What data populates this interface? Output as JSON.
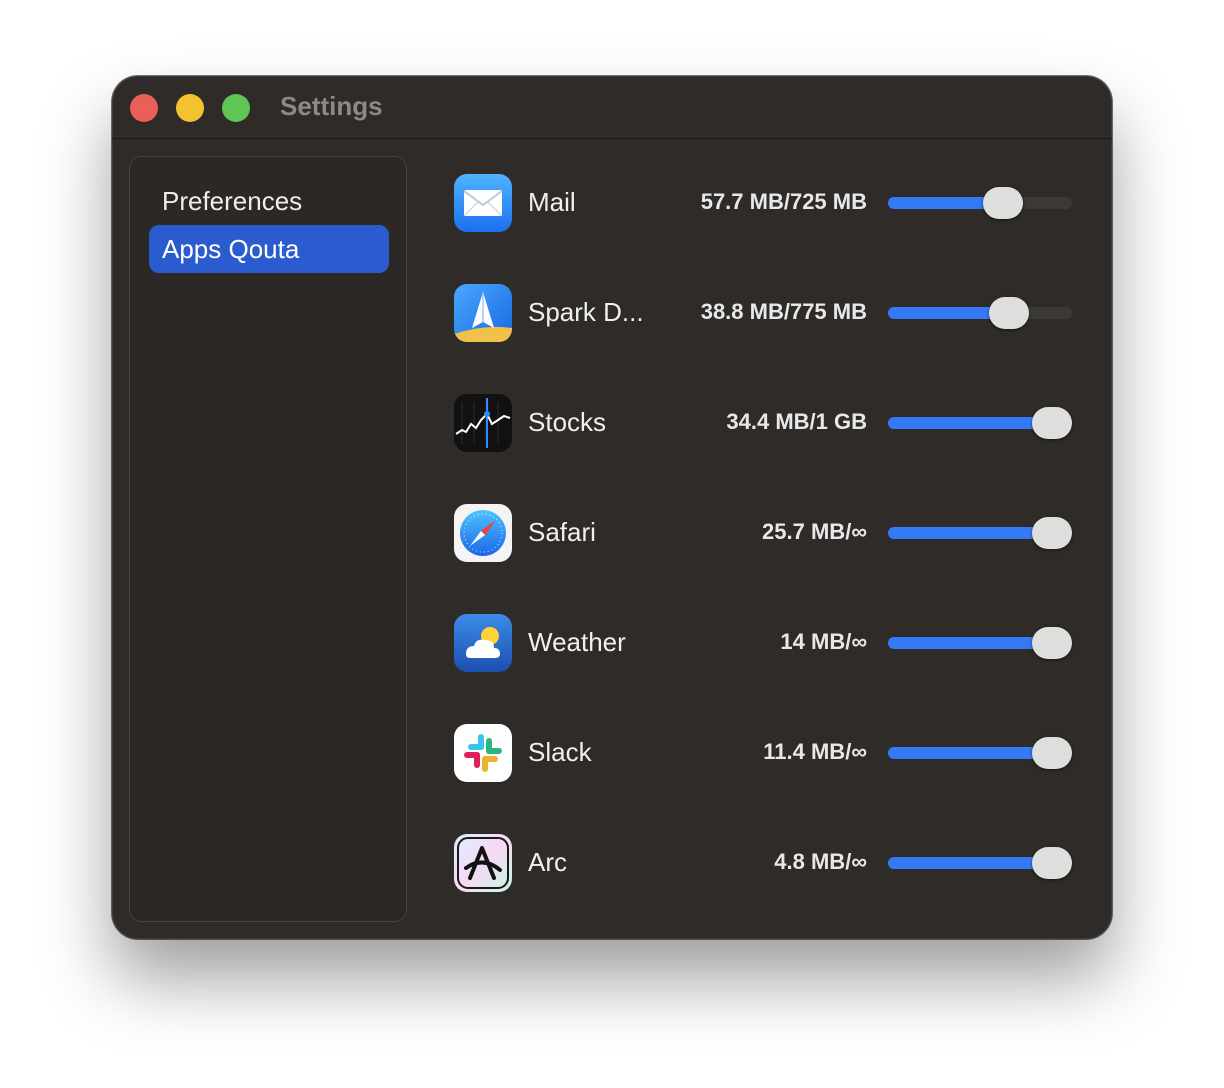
{
  "window": {
    "title": "Settings",
    "traffic_lights": {
      "close": "#ec5f57",
      "minimize": "#f4c22f",
      "zoom": "#5fc553"
    }
  },
  "sidebar": {
    "items": [
      {
        "label": "Preferences",
        "selected": false
      },
      {
        "label": "Apps Qouta",
        "selected": true
      }
    ]
  },
  "apps": [
    {
      "name": "Mail",
      "usage": "57.7 MB/725 MB",
      "icon": "mail-icon",
      "quota_level": 0.66
    },
    {
      "name": "Spark D...",
      "usage": "38.8 MB/775 MB",
      "icon": "spark-icon",
      "quota_level": 0.7
    },
    {
      "name": "Stocks",
      "usage": "34.4 MB/1 GB",
      "icon": "stocks-icon",
      "quota_level": 1.0
    },
    {
      "name": "Safari",
      "usage": "25.7 MB/∞",
      "icon": "safari-icon",
      "quota_level": 1.0
    },
    {
      "name": "Weather",
      "usage": "14 MB/∞",
      "icon": "weather-icon",
      "quota_level": 1.0
    },
    {
      "name": "Slack",
      "usage": "11.4 MB/∞",
      "icon": "slack-icon",
      "quota_level": 1.0
    },
    {
      "name": "Arc",
      "usage": "4.8 MB/∞",
      "icon": "arc-icon",
      "quota_level": 1.0
    }
  ],
  "colors": {
    "accent": "#3479f6",
    "selection": "#2a5ccf",
    "window_bg": "#2e2b28"
  }
}
